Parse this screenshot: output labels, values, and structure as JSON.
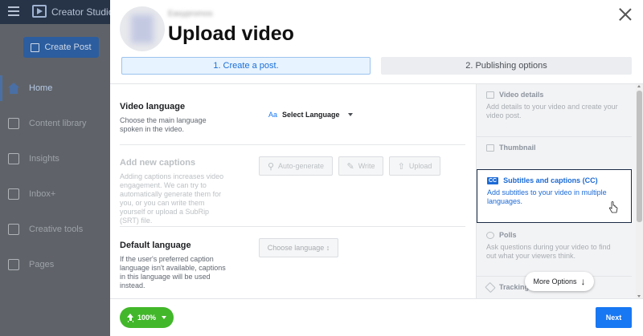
{
  "app": {
    "title": "Creator Studio"
  },
  "sidebar": {
    "create_label": "Create Post",
    "items": [
      {
        "label": "Home",
        "icon": "home-icon",
        "active": true
      },
      {
        "label": "Content library",
        "icon": "library-icon"
      },
      {
        "label": "Insights",
        "icon": "chart-icon"
      },
      {
        "label": "Inbox+",
        "icon": "inbox-icon"
      },
      {
        "label": "Creative tools",
        "icon": "tools-icon"
      },
      {
        "label": "Pages",
        "icon": "pages-icon"
      }
    ]
  },
  "modal": {
    "page_name": "Easypromos",
    "title": "Upload video",
    "steps": [
      "1. Create a post.",
      "2. Publishing options"
    ],
    "sections": {
      "video_language": {
        "title": "Video language",
        "desc": "Choose the main language spoken in the video.",
        "select_prefix": "Aa",
        "select_label": "Select Language"
      },
      "captions": {
        "title": "Add new captions",
        "desc": "Adding captions increases video engagement. We can try to automatically generate them for you, or you can write them yourself or upload a SubRip (SRT) file.",
        "buttons": [
          "Auto-generate",
          "Write",
          "Upload"
        ]
      },
      "default_language": {
        "title": "Default language",
        "desc": "If the user's preferred caption language isn't available, captions in this language will be used instead.",
        "select_label": "Choose language ↕"
      }
    },
    "options": [
      {
        "title": "Video details",
        "desc": "Add details to your video and create your video post."
      },
      {
        "title": "Thumbnail",
        "desc": ""
      },
      {
        "title": "Subtitles and captions (CC)",
        "badge": "CC",
        "desc": "Add subtitles to your video in multiple languages.",
        "selected": true
      },
      {
        "title": "Polls",
        "desc": "Ask questions during your video to find out what your viewers think."
      },
      {
        "title": "Tracking",
        "desc": ""
      }
    ],
    "more_options": "More Options",
    "progress": "100%",
    "next_label": "Next"
  },
  "colors": {
    "primary": "#1877f2",
    "success": "#42b72a",
    "selected_border": "#1b2a44"
  }
}
